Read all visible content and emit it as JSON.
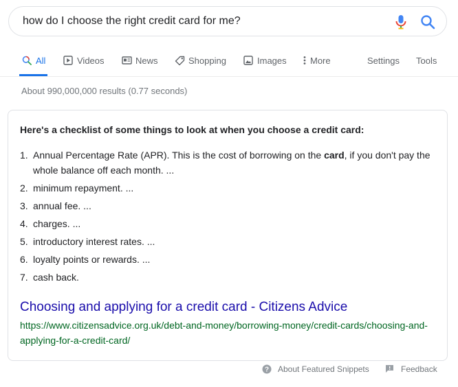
{
  "search": {
    "query": "how do I choose the right credit card for me?"
  },
  "tabs": {
    "all": "All",
    "videos": "Videos",
    "news": "News",
    "shopping": "Shopping",
    "images": "Images",
    "more": "More",
    "settings": "Settings",
    "tools": "Tools"
  },
  "results_stats": "About 990,000,000 results (0.77 seconds)",
  "snippet": {
    "heading": "Here's a checklist of some things to look at when you choose a credit card:",
    "items": [
      {
        "num": "1.",
        "before": "Annual Percentage Rate (APR). This is the cost of borrowing on the ",
        "bold": "card",
        "after": ", if you don't pay the whole balance off each month. ..."
      },
      {
        "num": "2.",
        "text": "minimum repayment. ..."
      },
      {
        "num": "3.",
        "text": "annual fee. ..."
      },
      {
        "num": "4.",
        "text": "charges. ..."
      },
      {
        "num": "5.",
        "text": "introductory interest rates. ..."
      },
      {
        "num": "6.",
        "text": "loyalty points or rewards. ..."
      },
      {
        "num": "7.",
        "text": "cash back."
      }
    ],
    "result_title": "Choosing and applying for a credit card - Citizens Advice",
    "result_url": "https://www.citizensadvice.org.uk/debt-and-money/borrowing-money/credit-cards/choosing-and-applying-for-a-credit-card/"
  },
  "footer": {
    "about_snippets": "About Featured Snippets",
    "feedback": "Feedback"
  },
  "colors": {
    "accent": "#1a73e8",
    "link": "#1a0dab",
    "url_green": "#006621"
  }
}
